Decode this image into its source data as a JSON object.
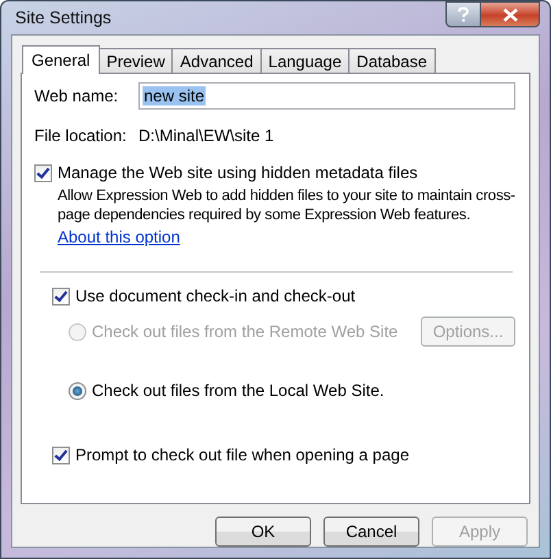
{
  "window": {
    "title": "Site Settings"
  },
  "tabs": [
    {
      "label": "General",
      "selected": true
    },
    {
      "label": "Preview",
      "selected": false
    },
    {
      "label": "Advanced",
      "selected": false
    },
    {
      "label": "Language",
      "selected": false
    },
    {
      "label": "Database",
      "selected": false
    }
  ],
  "web_name": {
    "label": "Web name:",
    "value": "new site",
    "selected": true
  },
  "file_location": {
    "label": "File location:",
    "value": "D:\\Minal\\EW\\site 1"
  },
  "metadata": {
    "label": "Manage the Web site using hidden metadata files",
    "checked": true,
    "description": "Allow Expression Web to add hidden files to your site to maintain cross-page dependencies required by some Expression Web features.",
    "link": "About this option"
  },
  "checkin": {
    "label": "Use document check-in and check-out",
    "checked": true
  },
  "checkout_sources": [
    {
      "label": "Check out files from the Remote Web Site",
      "selected": false,
      "disabled": true
    },
    {
      "label": "Check out files from the Local Web Site.",
      "selected": true,
      "disabled": false
    }
  ],
  "options_button": {
    "label": "Options...",
    "disabled": true
  },
  "prompt": {
    "label": "Prompt to check out file when opening a page",
    "checked": true
  },
  "buttons": [
    {
      "label": "OK",
      "disabled": false
    },
    {
      "label": "Cancel",
      "disabled": false
    },
    {
      "label": "Apply",
      "disabled": true
    }
  ]
}
